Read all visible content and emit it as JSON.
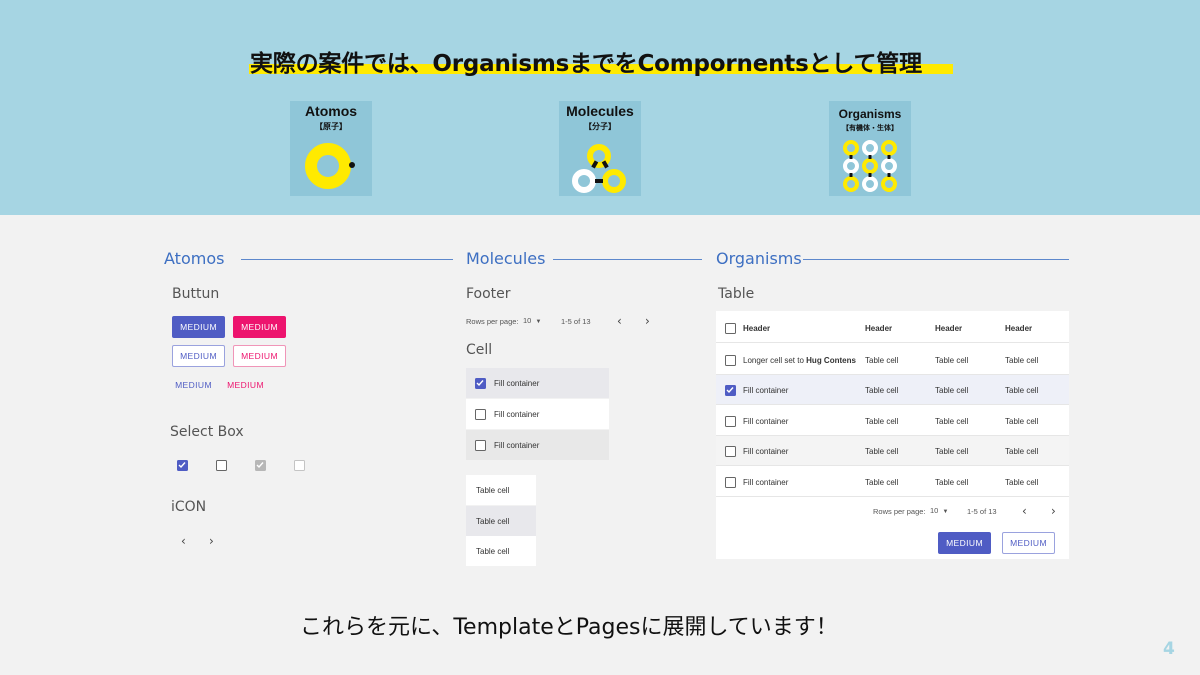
{
  "headline": "実際の案件では、OrganismsまでをCompornentsとして管理",
  "cards": [
    {
      "title": "Atomos",
      "sub": "【原子】"
    },
    {
      "title": "Molecules",
      "sub": "【分子】"
    },
    {
      "title": "Organisms",
      "sub": "【有機体・生体】"
    }
  ],
  "sections": {
    "atomos": "Atomos",
    "molecules": "Molecules",
    "organisms": "Organisms"
  },
  "atomos": {
    "button_heading": "Buttun",
    "buttons": [
      "MEDIUM",
      "MEDIUM",
      "MEDIUM",
      "MEDIUM",
      "MEDIUM",
      "MEDIUM"
    ],
    "select_heading": "Select Box",
    "icon_heading": "iCON",
    "icons": {
      "prev": "‹",
      "next": "›"
    }
  },
  "molecules": {
    "footer_heading": "Footer",
    "rows_label": "Rows per page:",
    "rows_value": "10",
    "range": "1-5 of 13",
    "cell_heading": "Cell",
    "cells": [
      "Fill container",
      "Fill container",
      "Fill container"
    ],
    "table_cells": [
      "Table cell",
      "Table cell",
      "Table cell"
    ]
  },
  "organisms": {
    "table_heading": "Table",
    "headers": [
      "Header",
      "Header",
      "Header",
      "Header"
    ],
    "row0_prefix": "Longer cell set to ",
    "row0_bold": "Hug Contens",
    "fill": "Fill container",
    "cell": "Table cell",
    "rows_label": "Rows per page:",
    "rows_value": "10",
    "range": "1-5 of 13",
    "btn_primary": "MEDIUM",
    "btn_outline": "MEDIUM"
  },
  "bottom_text": "これらを元に、TemplateとPagesに展開しています！",
  "page_number": "4",
  "colors": {
    "banner": "#a6d5e3",
    "highlight": "#ffea00",
    "primary": "#4f5cc4",
    "pink": "#ed146e",
    "heading_blue": "#3d6fc2"
  }
}
